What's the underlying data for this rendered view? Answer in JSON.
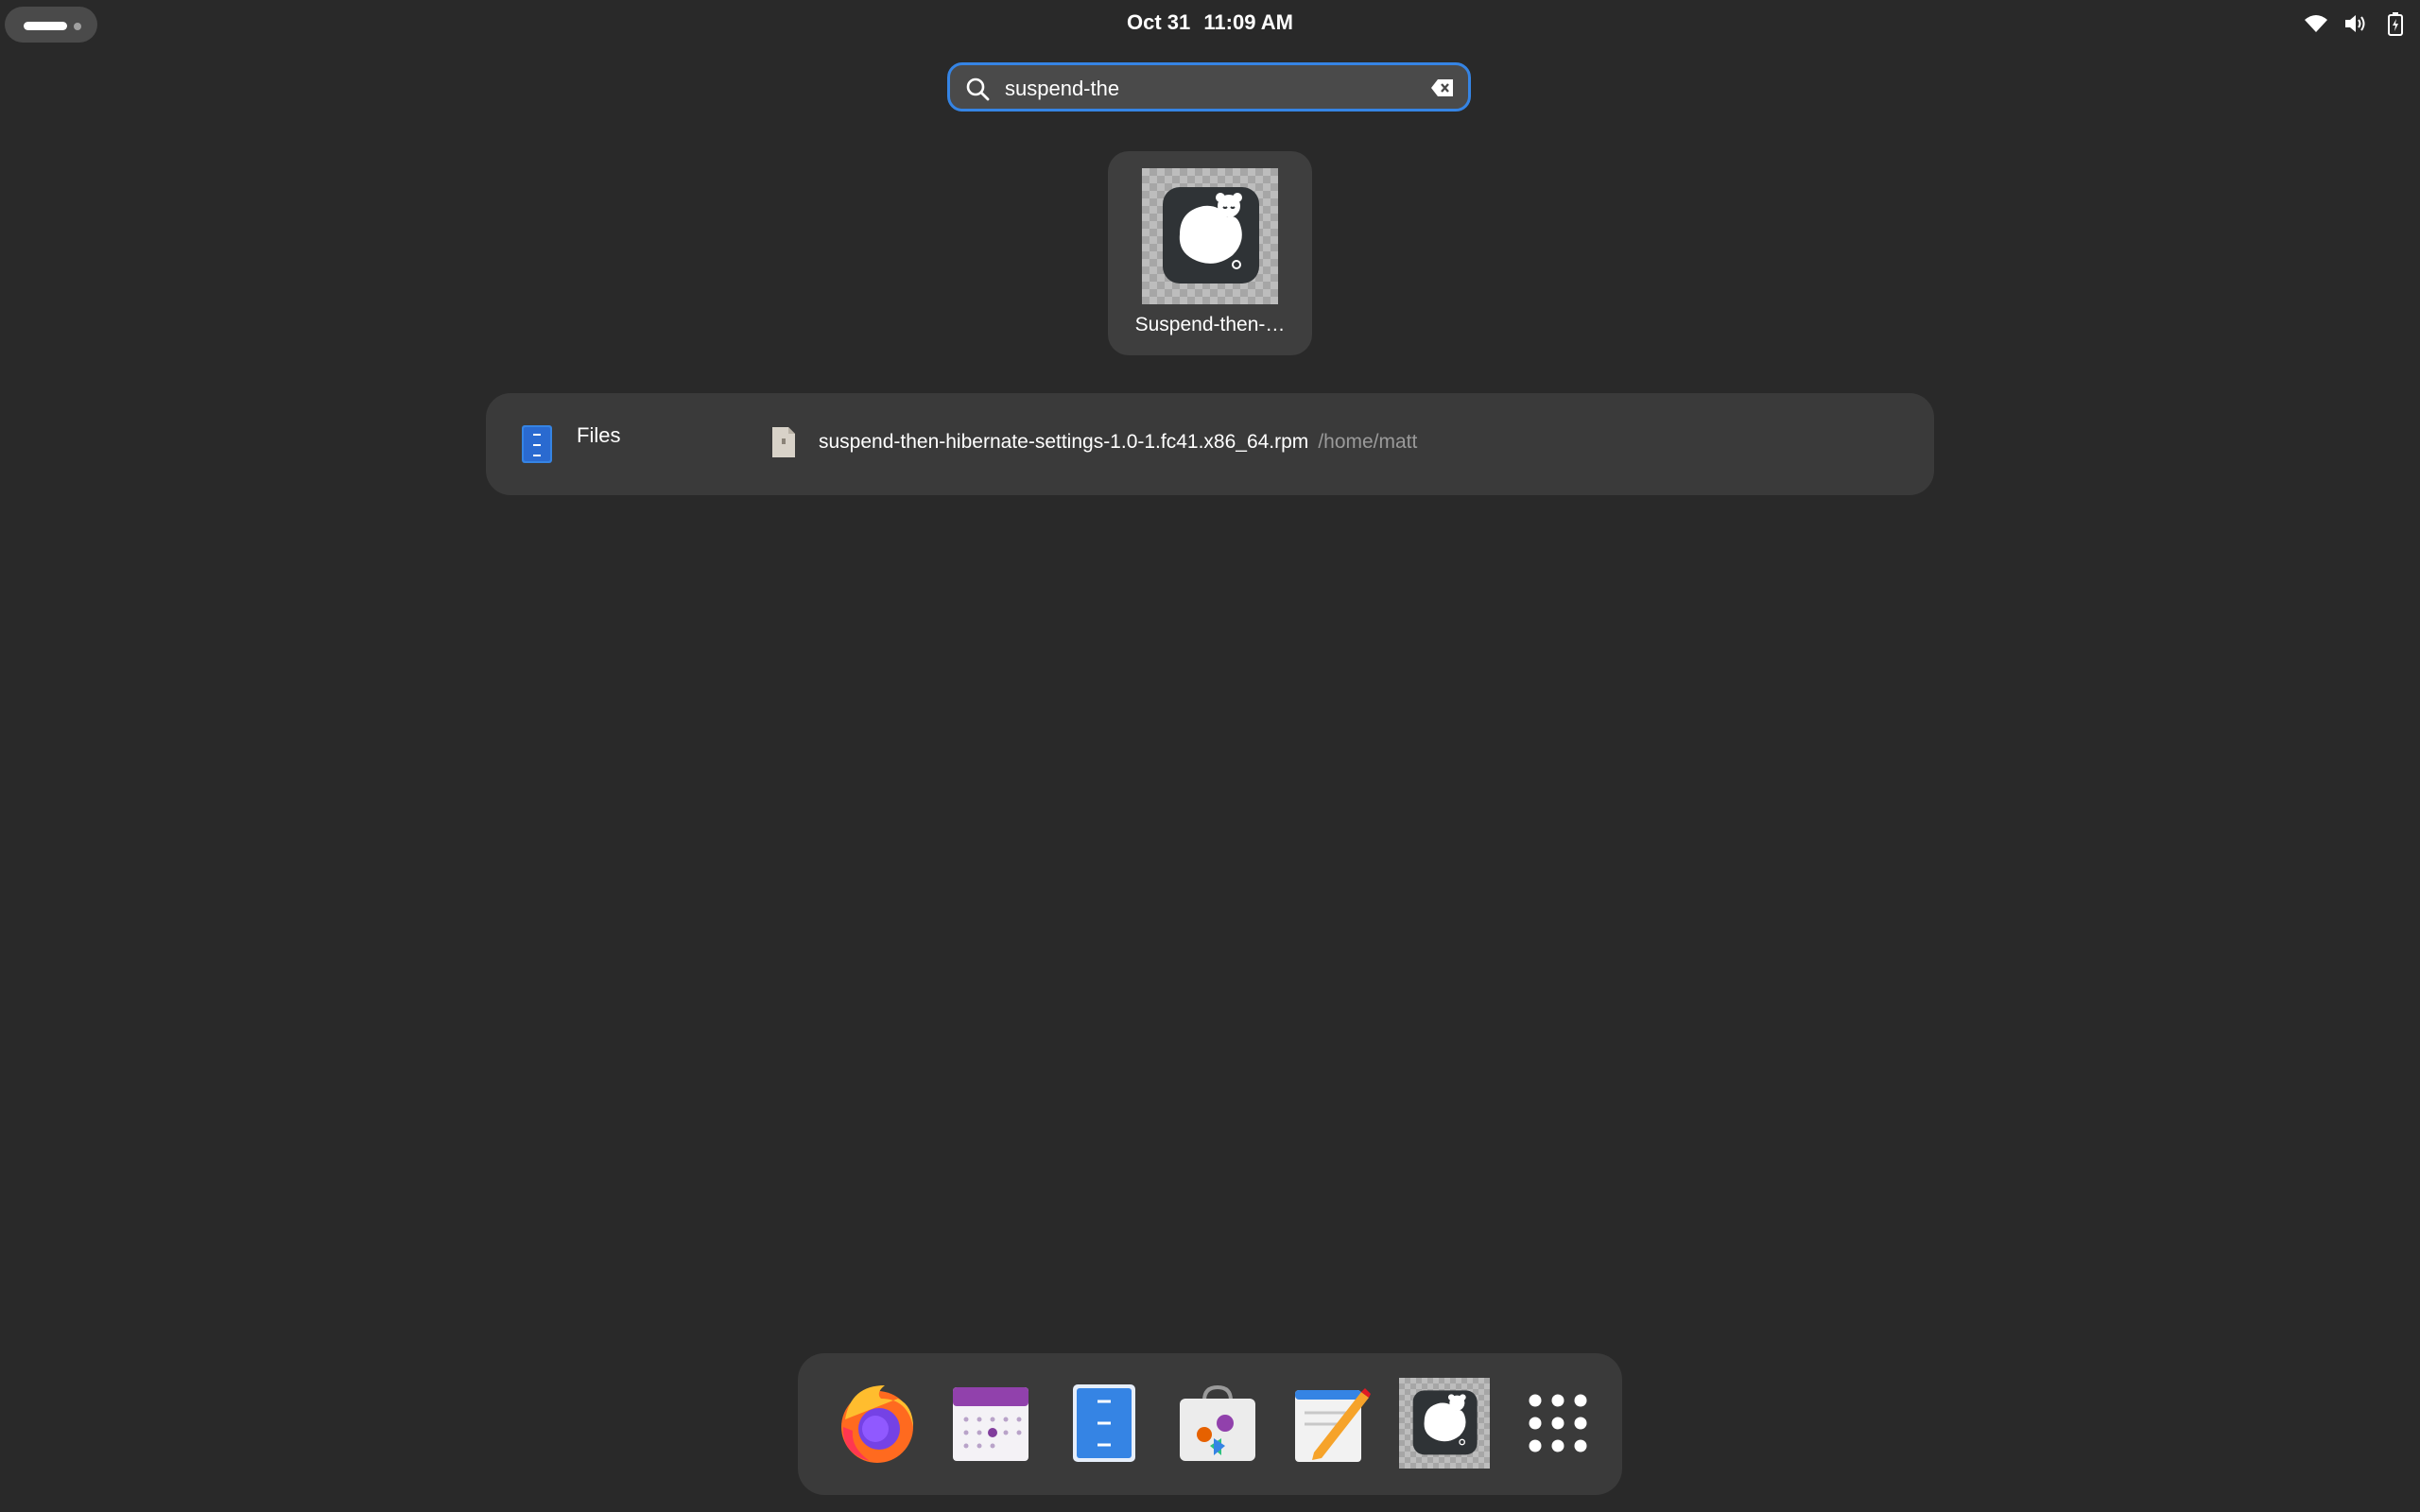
{
  "topbar": {
    "date": "Oct 31",
    "time": "11:09 AM",
    "tray_icons": [
      "wifi-icon",
      "volume-icon",
      "battery-icon"
    ]
  },
  "search": {
    "value": "suspend-the"
  },
  "app_results": [
    {
      "label": "Suspend-then-…",
      "icon": "sleeping-bear-icon"
    }
  ],
  "file_results": {
    "provider": "Files",
    "items": [
      {
        "name": "suspend-then-hibernate-settings-1.0-1.fc41.x86_64.rpm",
        "path": "/home/matt"
      }
    ]
  },
  "dock": {
    "items": [
      {
        "name": "firefox-icon"
      },
      {
        "name": "calendar-icon"
      },
      {
        "name": "files-icon"
      },
      {
        "name": "software-icon"
      },
      {
        "name": "text-editor-icon"
      },
      {
        "name": "suspend-then-hibernate-icon"
      },
      {
        "name": "show-apps-icon"
      }
    ]
  },
  "colors": {
    "background": "#292929",
    "accent": "#3584e4",
    "panel": "#3a3a3a"
  }
}
